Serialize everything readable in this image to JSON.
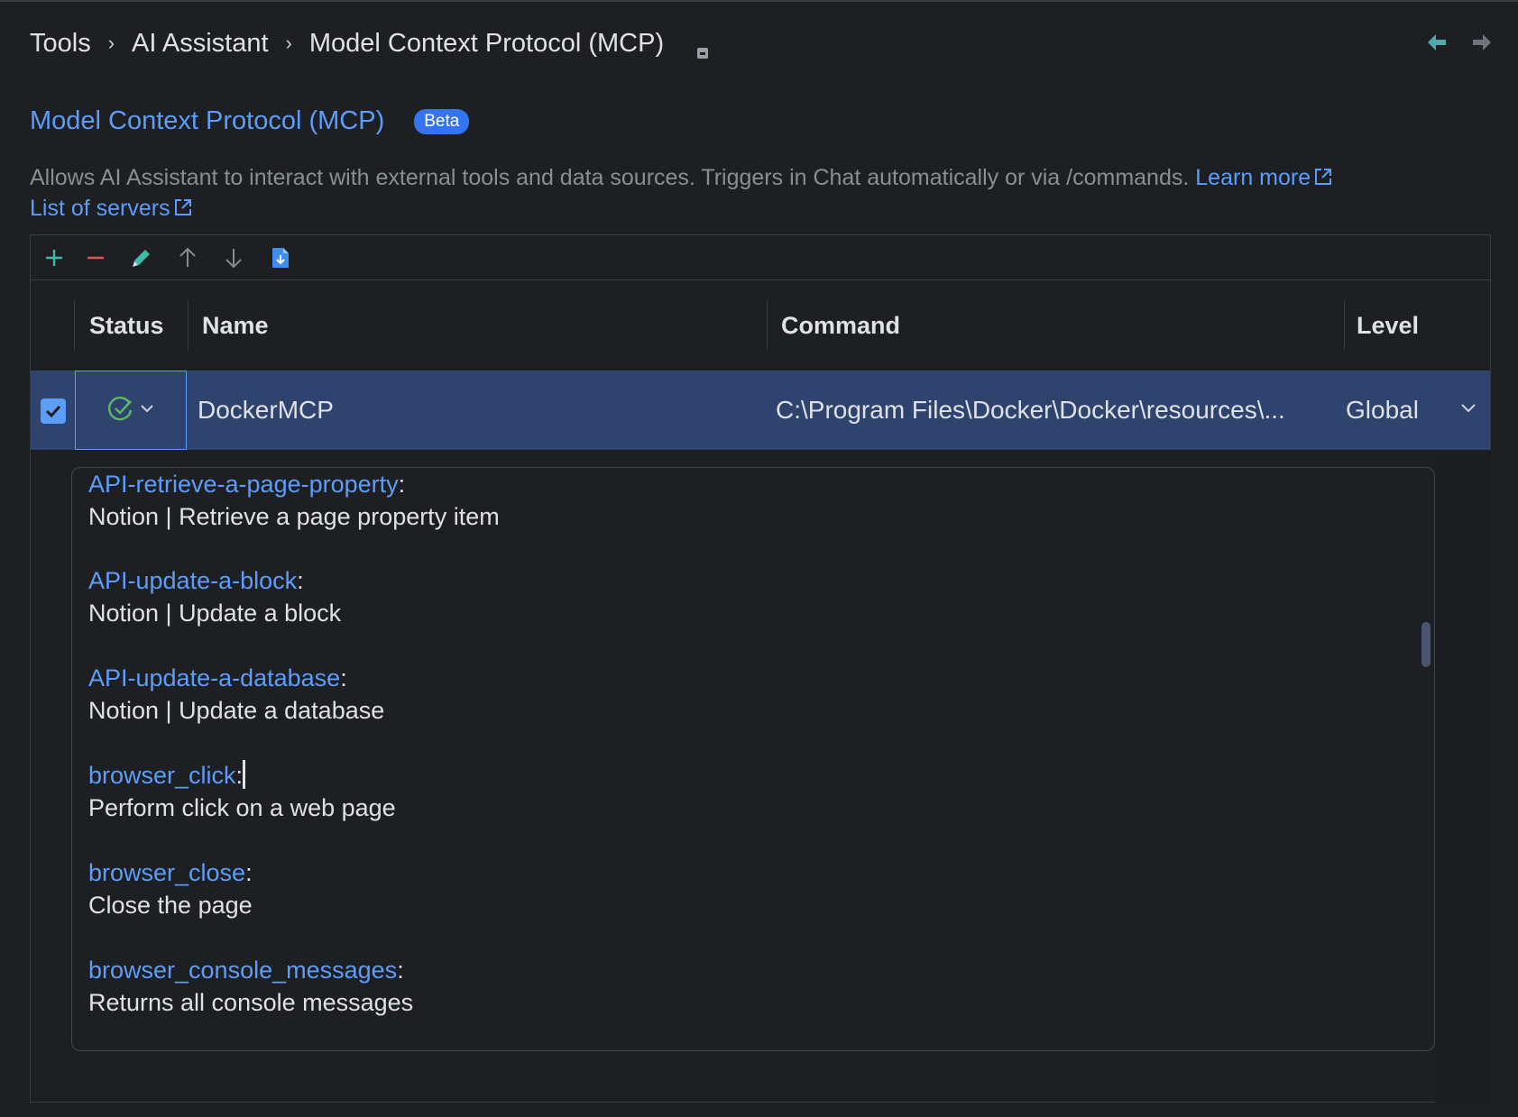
{
  "breadcrumb": {
    "items": [
      "Tools",
      "AI Assistant",
      "Model Context Protocol (MCP)"
    ],
    "separator": "›"
  },
  "page": {
    "title": "Model Context Protocol (MCP)",
    "badge": "Beta",
    "description": "Allows AI Assistant to interact with external tools and data sources. Triggers in Chat automatically or via /commands.",
    "learn_more": "Learn more",
    "list_of_servers": "List of servers"
  },
  "table": {
    "columns": [
      "Status",
      "Name",
      "Command",
      "Level"
    ],
    "rows": [
      {
        "enabled": true,
        "status": "connected",
        "name": "DockerMCP",
        "command": "C:\\Program Files\\Docker\\Docker\\resources\\...",
        "level": "Global"
      }
    ]
  },
  "tools": [
    {
      "name": "API-retrieve-a-page-property",
      "description": "Notion | Retrieve a page property item"
    },
    {
      "name": "API-update-a-block",
      "description": "Notion | Update a block"
    },
    {
      "name": "API-update-a-database",
      "description": "Notion | Update a database"
    },
    {
      "name": "browser_click",
      "description": "Perform click on a web page"
    },
    {
      "name": "browser_close",
      "description": "Close the page"
    },
    {
      "name": "browser_console_messages",
      "description": "Returns all console messages"
    }
  ],
  "colors": {
    "accent": "#5c9dfa",
    "selection": "#2e436e",
    "success": "#5fb865",
    "danger": "#e5534b",
    "badge": "#3574f0"
  },
  "icons": {
    "toolbar": [
      "add-icon",
      "remove-icon",
      "edit-icon",
      "move-up-icon",
      "move-down-icon",
      "import-icon"
    ],
    "nav": [
      "back-arrow-icon",
      "forward-arrow-icon"
    ]
  }
}
